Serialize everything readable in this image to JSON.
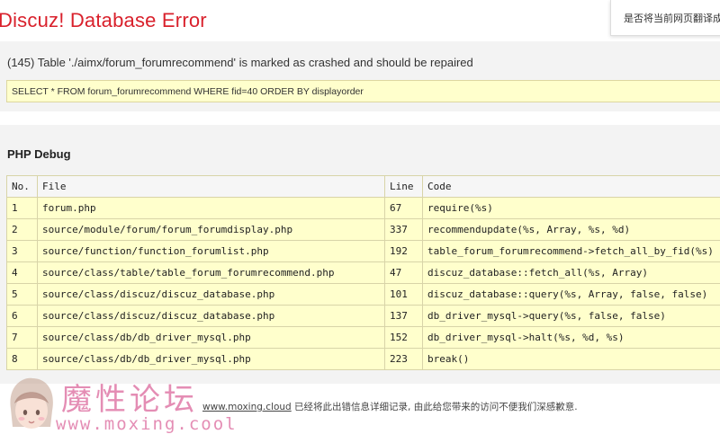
{
  "error_title": "Discuz! Database Error",
  "translate_prompt": "是否将当前网页翻译成",
  "error_message": "(145) Table './aimx/forum_forumrecommend' is marked as crashed and should be repaired",
  "sql_query": "SELECT * FROM forum_forumrecommend WHERE fid=40 ORDER BY displayorder",
  "debug_title": "PHP Debug",
  "table": {
    "headers": [
      "No.",
      "File",
      "Line",
      "Code"
    ],
    "rows": [
      [
        "1",
        "forum.php",
        "67",
        "require(%s)"
      ],
      [
        "2",
        "source/module/forum/forum_forumdisplay.php",
        "337",
        "recommendupdate(%s, Array, %s, %d)"
      ],
      [
        "3",
        "source/function/function_forumlist.php",
        "192",
        "table_forum_forumrecommend->fetch_all_by_fid(%s)"
      ],
      [
        "4",
        "source/class/table/table_forum_forumrecommend.php",
        "47",
        "discuz_database::fetch_all(%s, Array)"
      ],
      [
        "5",
        "source/class/discuz/discuz_database.php",
        "101",
        "discuz_database::query(%s, Array, false, false)"
      ],
      [
        "6",
        "source/class/discuz/discuz_database.php",
        "137",
        "db_driver_mysql->query(%s, false, false)"
      ],
      [
        "7",
        "source/class/db/db_driver_mysql.php",
        "152",
        "db_driver_mysql->halt(%s, %d, %s)"
      ],
      [
        "8",
        "source/class/db/db_driver_mysql.php",
        "223",
        "break()"
      ]
    ]
  },
  "footer": {
    "link_text": "www.moxing.cloud",
    "message": " 已经将此出错信息详细记录, 由此给您带来的访问不便我们深感歉意."
  },
  "watermark": {
    "chinese": "魔性论坛",
    "url": "www.moxing.cool",
    "icon": "girl-face-icon"
  },
  "colors": {
    "title_red": "#d9212c",
    "highlight_yellow": "#ffffcc",
    "panel_gray": "#f3f3f3",
    "watermark_pink": "#e07aa8"
  }
}
